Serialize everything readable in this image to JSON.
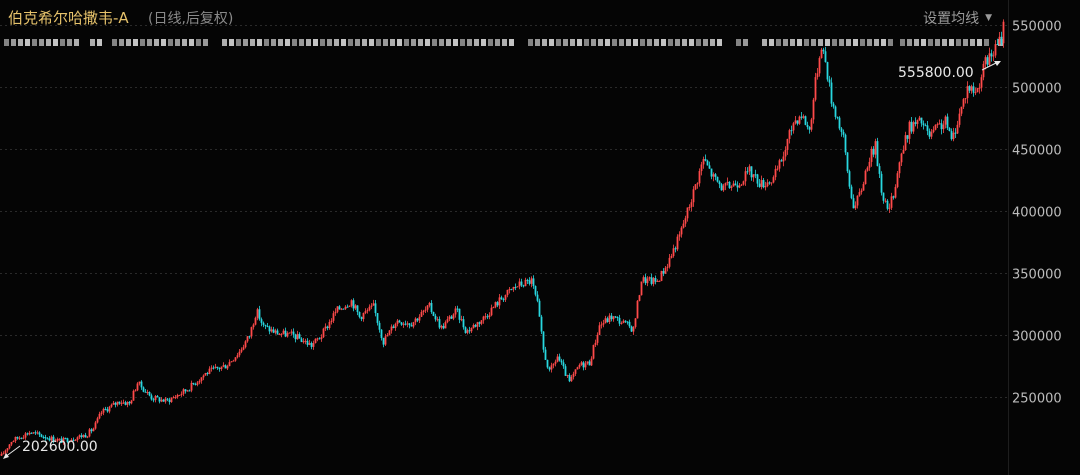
{
  "header": {
    "title": "伯克希尔哈撒韦-A",
    "subtitle": "(日线,后复权)",
    "ma_setting_label": "设置均线"
  },
  "colors": {
    "background": "#050505",
    "up": "#ff4a4a",
    "down": "#28d8e0",
    "grid": "#2a2a2a",
    "title": "#e6c26b"
  },
  "chart_data": {
    "type": "candlestick",
    "title": "伯克希尔哈撒韦-A",
    "subtitle": "(日线,后复权)",
    "y_axis_position": "right",
    "ylim": [
      198000,
      562000
    ],
    "y_ticks": [
      250000,
      300000,
      350000,
      400000,
      450000,
      500000,
      550000
    ],
    "y_tick_labels": [
      "250000",
      "300000",
      "350000",
      "400000",
      "450000",
      "500000",
      "550000"
    ],
    "grid": "horizontal dashed",
    "low_marker": {
      "label": "202600.00",
      "value": 202600
    },
    "high_marker": {
      "label": "555800.00",
      "value": 555800
    },
    "price_path_knots": [
      [
        0,
        203000
      ],
      [
        10,
        215000
      ],
      [
        28,
        222000
      ],
      [
        45,
        218000
      ],
      [
        60,
        215000
      ],
      [
        85,
        220000
      ],
      [
        92,
        225000
      ],
      [
        100,
        238000
      ],
      [
        118,
        247000
      ],
      [
        128,
        245000
      ],
      [
        136,
        262000
      ],
      [
        150,
        250000
      ],
      [
        165,
        247000
      ],
      [
        185,
        256000
      ],
      [
        205,
        270000
      ],
      [
        225,
        276000
      ],
      [
        238,
        287000
      ],
      [
        248,
        300000
      ],
      [
        255,
        320000
      ],
      [
        262,
        307000
      ],
      [
        275,
        302000
      ],
      [
        292,
        300000
      ],
      [
        310,
        292000
      ],
      [
        320,
        300000
      ],
      [
        335,
        320000
      ],
      [
        350,
        328000
      ],
      [
        358,
        315000
      ],
      [
        372,
        323000
      ],
      [
        382,
        295000
      ],
      [
        395,
        312000
      ],
      [
        410,
        310000
      ],
      [
        428,
        323000
      ],
      [
        440,
        306000
      ],
      [
        455,
        320000
      ],
      [
        465,
        303000
      ],
      [
        482,
        314000
      ],
      [
        500,
        330000
      ],
      [
        515,
        340000
      ],
      [
        530,
        344000
      ],
      [
        536,
        325000
      ],
      [
        542,
        288000
      ],
      [
        548,
        270000
      ],
      [
        556,
        283000
      ],
      [
        568,
        262000
      ],
      [
        578,
        276000
      ],
      [
        588,
        278000
      ],
      [
        598,
        308000
      ],
      [
        610,
        315000
      ],
      [
        622,
        310000
      ],
      [
        632,
        305000
      ],
      [
        640,
        345000
      ],
      [
        655,
        343000
      ],
      [
        665,
        356000
      ],
      [
        678,
        380000
      ],
      [
        688,
        405000
      ],
      [
        702,
        442000
      ],
      [
        712,
        427000
      ],
      [
        722,
        418000
      ],
      [
        738,
        424000
      ],
      [
        748,
        432000
      ],
      [
        760,
        422000
      ],
      [
        772,
        426000
      ],
      [
        782,
        445000
      ],
      [
        792,
        472000
      ],
      [
        800,
        478000
      ],
      [
        808,
        465000
      ],
      [
        815,
        510000
      ],
      [
        820,
        535000
      ],
      [
        824,
        520000
      ],
      [
        830,
        490000
      ],
      [
        836,
        475000
      ],
      [
        842,
        458000
      ],
      [
        848,
        420000
      ],
      [
        853,
        402000
      ],
      [
        860,
        418000
      ],
      [
        867,
        442000
      ],
      [
        874,
        452000
      ],
      [
        880,
        418000
      ],
      [
        886,
        400000
      ],
      [
        891,
        410000
      ],
      [
        898,
        440000
      ],
      [
        908,
        468000
      ],
      [
        920,
        472000
      ],
      [
        928,
        460000
      ],
      [
        937,
        468000
      ],
      [
        945,
        472000
      ],
      [
        950,
        456000
      ],
      [
        958,
        478000
      ],
      [
        966,
        500000
      ],
      [
        975,
        496000
      ],
      [
        983,
        518000
      ],
      [
        992,
        528000
      ],
      [
        1000,
        540000
      ],
      [
        1003,
        555800
      ]
    ]
  }
}
